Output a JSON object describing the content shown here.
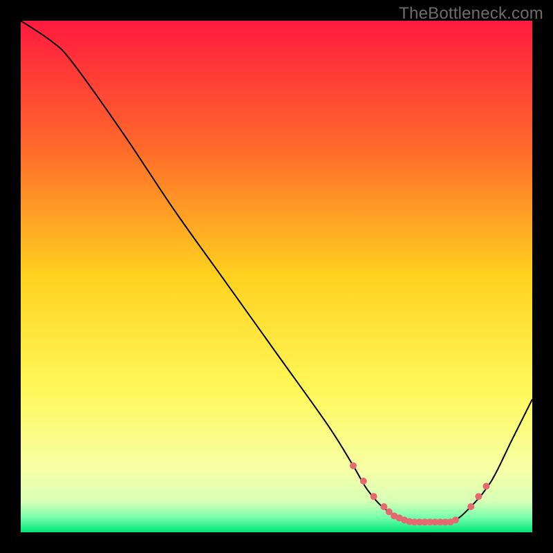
{
  "watermark": "TheBottleneck.com",
  "chart_data": {
    "type": "line",
    "title": "",
    "xlabel": "",
    "ylabel": "",
    "xlim": [
      0,
      100
    ],
    "ylim": [
      0,
      100
    ],
    "background_gradient_stops": [
      {
        "offset": 0,
        "color": "#ff1a3f"
      },
      {
        "offset": 0.25,
        "color": "#ff6a2a"
      },
      {
        "offset": 0.5,
        "color": "#ffd21f"
      },
      {
        "offset": 0.72,
        "color": "#fff85a"
      },
      {
        "offset": 0.88,
        "color": "#f6ffa7"
      },
      {
        "offset": 0.94,
        "color": "#d6ffb7"
      },
      {
        "offset": 0.97,
        "color": "#7bffad"
      },
      {
        "offset": 1.0,
        "color": "#00e676"
      }
    ],
    "curve": {
      "color": "#000000",
      "x": [
        0,
        6,
        10,
        20,
        30,
        40,
        50,
        60,
        65,
        68,
        72,
        78,
        84,
        88,
        92,
        96,
        100
      ],
      "y": [
        100,
        96,
        92,
        78,
        63,
        49,
        35,
        21,
        13,
        8,
        4,
        2,
        2,
        5,
        10,
        18,
        26
      ]
    },
    "dots": {
      "color": "#e46a6f",
      "radius": 5,
      "points": [
        {
          "x": 65,
          "y": 13
        },
        {
          "x": 67,
          "y": 10
        },
        {
          "x": 69,
          "y": 7
        },
        {
          "x": 71,
          "y": 5
        },
        {
          "x": 72,
          "y": 4
        },
        {
          "x": 73,
          "y": 3.2
        },
        {
          "x": 74,
          "y": 2.8
        },
        {
          "x": 75,
          "y": 2.4
        },
        {
          "x": 76,
          "y": 2.1
        },
        {
          "x": 77,
          "y": 2.0
        },
        {
          "x": 78,
          "y": 2.0
        },
        {
          "x": 79,
          "y": 2.0
        },
        {
          "x": 80,
          "y": 2.0
        },
        {
          "x": 81,
          "y": 2.0
        },
        {
          "x": 82,
          "y": 2.0
        },
        {
          "x": 83,
          "y": 2.0
        },
        {
          "x": 84,
          "y": 2.0
        },
        {
          "x": 85,
          "y": 2.4
        },
        {
          "x": 88,
          "y": 5
        },
        {
          "x": 89.5,
          "y": 7
        },
        {
          "x": 91,
          "y": 9
        }
      ]
    }
  }
}
